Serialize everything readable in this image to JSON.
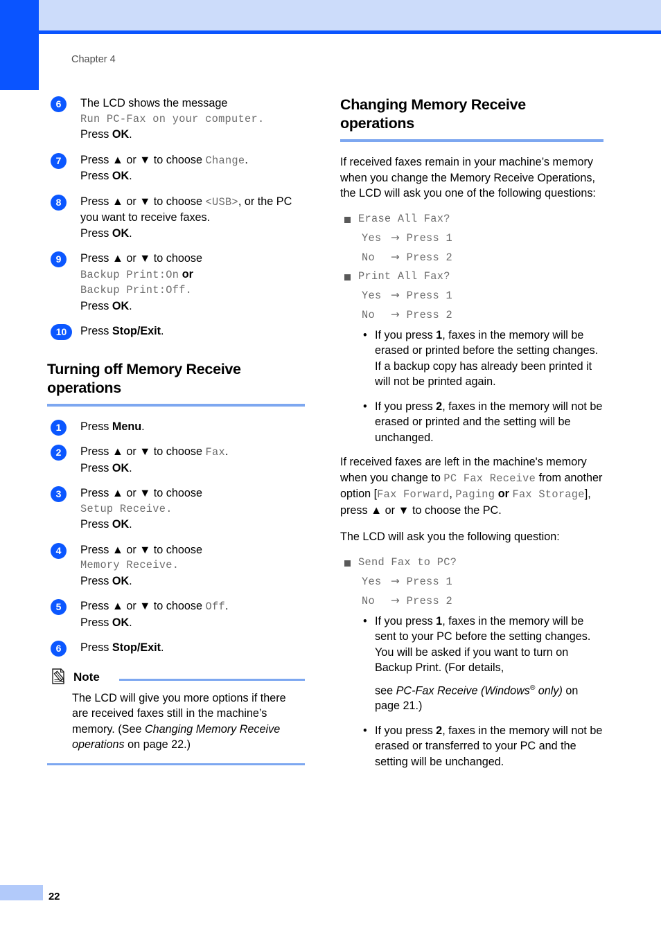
{
  "page": {
    "chapter_label": "Chapter 4",
    "page_number": "22"
  },
  "left_column": {
    "steps_top": [
      {
        "number": "6",
        "lines": [
          {
            "type": "text",
            "value": "The LCD shows the message"
          },
          {
            "type": "lcd",
            "value": "Run PC-Fax on your computer."
          },
          {
            "type": "press",
            "prefix": "Press ",
            "key": "OK",
            "suffix": "."
          }
        ]
      },
      {
        "number": "7",
        "lines": [
          {
            "type": "mixed",
            "pre": "Press ▲ or ▼ to choose ",
            "lcd": "Change",
            "post": "."
          },
          {
            "type": "press",
            "prefix": "Press ",
            "key": "OK",
            "suffix": "."
          }
        ]
      },
      {
        "number": "8",
        "lines": [
          {
            "type": "mixed2",
            "pre": "Press ▲ or ▼ to choose ",
            "lcd": "<USB>",
            "post": ", or the PC you want to receive faxes."
          },
          {
            "type": "press",
            "prefix": "Press ",
            "key": "OK",
            "suffix": "."
          }
        ]
      },
      {
        "number": "9",
        "lines": [
          {
            "type": "text",
            "value": "Press ▲ or ▼ to choose"
          },
          {
            "type": "lcd_or",
            "lcd1": "Backup Print:On",
            "mid": " or",
            "lcd2": "Backup Print:Off."
          },
          {
            "type": "press",
            "prefix": "Press ",
            "key": "OK",
            "suffix": "."
          }
        ]
      },
      {
        "number": "10",
        "wide": true,
        "lines": [
          {
            "type": "press",
            "prefix": "Press ",
            "key": "Stop/Exit",
            "suffix": "."
          }
        ]
      }
    ],
    "heading": "Turning off Memory Receive operations",
    "steps_bottom": [
      {
        "number": "1",
        "lines": [
          {
            "type": "press",
            "prefix": "Press ",
            "key": "Menu",
            "suffix": "."
          }
        ]
      },
      {
        "number": "2",
        "lines": [
          {
            "type": "mixed",
            "pre": "Press ▲ or ▼ to choose ",
            "lcd": "Fax",
            "post": "."
          },
          {
            "type": "press",
            "prefix": "Press ",
            "key": "OK",
            "suffix": "."
          }
        ]
      },
      {
        "number": "3",
        "lines": [
          {
            "type": "text",
            "value": "Press ▲ or ▼ to choose"
          },
          {
            "type": "lcd",
            "value": "Setup Receive."
          },
          {
            "type": "press",
            "prefix": "Press ",
            "key": "OK",
            "suffix": "."
          }
        ]
      },
      {
        "number": "4",
        "lines": [
          {
            "type": "text",
            "value": "Press ▲ or ▼ to choose"
          },
          {
            "type": "lcd",
            "value": "Memory Receive."
          },
          {
            "type": "press",
            "prefix": "Press ",
            "key": "OK",
            "suffix": "."
          }
        ]
      },
      {
        "number": "5",
        "lines": [
          {
            "type": "mixed",
            "pre": "Press ▲ or ▼ to choose ",
            "lcd": "Off",
            "post": "."
          },
          {
            "type": "press",
            "prefix": "Press ",
            "key": "OK",
            "suffix": "."
          }
        ]
      },
      {
        "number": "6",
        "lines": [
          {
            "type": "press",
            "prefix": "Press ",
            "key": "Stop/Exit",
            "suffix": "."
          }
        ]
      }
    ],
    "note": {
      "icon": "note-pencil-icon",
      "title": "Note",
      "text_pre": "The LCD will give you more options if there are received faxes still in the machine’s memory. (See ",
      "text_italic": "Changing Memory Receive operations",
      "text_post": " on page 22.)"
    }
  },
  "right_column": {
    "heading": "Changing Memory Receive operations",
    "intro": "If received faxes remain in your machine’s memory when you change the Memory Receive Operations, the LCD will ask you one of the following questions:",
    "questions": [
      {
        "label": "Erase All Fax?",
        "answers": [
          {
            "key": "Yes",
            "arrow": "→",
            "action": "Press 1"
          },
          {
            "key": "No",
            "arrow": "→",
            "action": "Press 2"
          }
        ]
      },
      {
        "label": "Print All Fax?",
        "answers": [
          {
            "key": "Yes",
            "arrow": "→",
            "action": "Press 1"
          },
          {
            "key": "No",
            "arrow": "→",
            "action": "Press 2"
          }
        ]
      }
    ],
    "bullets_first": [
      {
        "pre": "If you press ",
        "key": "1",
        "post": ", faxes in the memory will be erased or printed before the setting changes. If a backup copy has already been printed it will not be printed again."
      },
      {
        "pre": "If you press ",
        "key": "2",
        "post": ", faxes in the memory will not be erased or printed and the setting will be unchanged."
      }
    ],
    "para_mixed": {
      "p1": "If received faxes are left in the machine's memory when you change to ",
      "lcd1": "PC Fax Receive",
      "p2": " from another option [",
      "lcd2": "Fax Forward",
      "p3": ", ",
      "lcd3": "Paging",
      "p4": " or ",
      "lcd4": "Fax Storage",
      "p5": "], press ▲ or ▼ to choose the PC."
    },
    "question_intro": "The LCD will ask you the following question:",
    "question_last": {
      "label": "Send Fax to PC?",
      "answers": [
        {
          "key": "Yes",
          "arrow": "→",
          "action": "Press 1"
        },
        {
          "key": "No",
          "arrow": "→",
          "action": "Press 2"
        }
      ]
    },
    "bullets_last": [
      {
        "pre": "If you press ",
        "key": "1",
        "post": ", faxes in the memory will be sent to your PC before the setting changes. You will be asked if you want to turn on Backup Print. (For details, ",
        "xref_pre": "see ",
        "xref_italic": "PC-Fax Receive (Windows",
        "xref_reg": "®",
        "xref_italic2": " only)",
        "xref_post": " on page 21.)"
      },
      {
        "pre": "If you press ",
        "key": "2",
        "post": ", faxes in the memory will not be erased or transferred to your PC and the setting will be unchanged."
      }
    ]
  }
}
